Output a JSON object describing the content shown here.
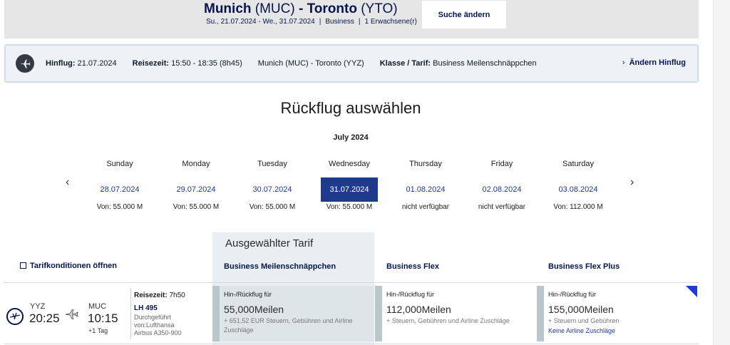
{
  "search": {
    "origin_city": "Munich",
    "origin_code": "(MUC)",
    "dash": "-",
    "dest_city": "Toronto",
    "dest_code": "(YTO)",
    "dates": "Su., 21.07.2024 - We., 31.07.2024",
    "cabin": "Business",
    "pax": "1 Erwachsene(r)",
    "sep": "|",
    "change_label": "Suche ändern"
  },
  "outbound": {
    "flight_label": "Hinflug:",
    "flight_date": "21.07.2024",
    "time_label": "Reisezeit:",
    "time_value": "15:50 - 18:35 (8h45)",
    "route": "Munich (MUC) - Toronto (YYZ)",
    "class_label": "Klasse / Tarif:",
    "class_value": "Business Meilenschnäppchen",
    "change_chevron": "›",
    "change_label": "Ändern Hinflug"
  },
  "return": {
    "title": "Rückflug auswählen",
    "month": "July 2024",
    "prev_arrow": "‹",
    "next_arrow": "›",
    "days": [
      {
        "name": "Sunday",
        "date": "28.07.2024",
        "price": "Von: 55.000 M"
      },
      {
        "name": "Monday",
        "date": "29.07.2024",
        "price": "Von: 55.000 M"
      },
      {
        "name": "Tuesday",
        "date": "30.07.2024",
        "price": "Von: 55.000 M"
      },
      {
        "name": "Wednesday",
        "date": "31.07.2024",
        "price": "Von: 55.000 M"
      },
      {
        "name": "Thursday",
        "date": "01.08.2024",
        "price": "nicht verfügbar"
      },
      {
        "name": "Friday",
        "date": "02.08.2024",
        "price": "nicht verfügbar"
      },
      {
        "name": "Saturday",
        "date": "03.08.2024",
        "price": "Von: 112.000 M"
      }
    ]
  },
  "tariffs": {
    "conditions_label": "Tarifkonditionen öffnen",
    "selected_label": "Ausgewählter Tarif",
    "columns": [
      "Business Meilenschnäppchen",
      "Business Flex",
      "Business Flex Plus"
    ]
  },
  "flight": {
    "dep_code": "YYZ",
    "dep_time": "20:25",
    "arr_code": "MUC",
    "arr_time": "10:15",
    "arr_next_day": "+1 Tag",
    "duration_label": "Reisezeit:",
    "duration_value": "7h50",
    "flight_number": "LH 495",
    "operated_1": "Durchgeführt",
    "operated_2": "von:Lufthansa",
    "aircraft": "Airbus A350-900",
    "fares": [
      {
        "route": "Hin-/Rückflug für",
        "miles": "55,000Meilen",
        "tax_1": "+ 651,52 EUR Steuern, Gebühren und Airline",
        "tax_2": "Zuschläge",
        "link": ""
      },
      {
        "route": "Hin-/Rückflug für",
        "miles": "112,000Meilen",
        "tax_1": "+ Steuern, Gebühren und Airline Zuschläge",
        "tax_2": "",
        "link": ""
      },
      {
        "route": "Hin-/Rückflug für",
        "miles": "155,000Meilen",
        "tax_1": "+ Steuern und Gebühren",
        "tax_2": "",
        "link": "Keine Airline Zuschläge"
      }
    ]
  }
}
